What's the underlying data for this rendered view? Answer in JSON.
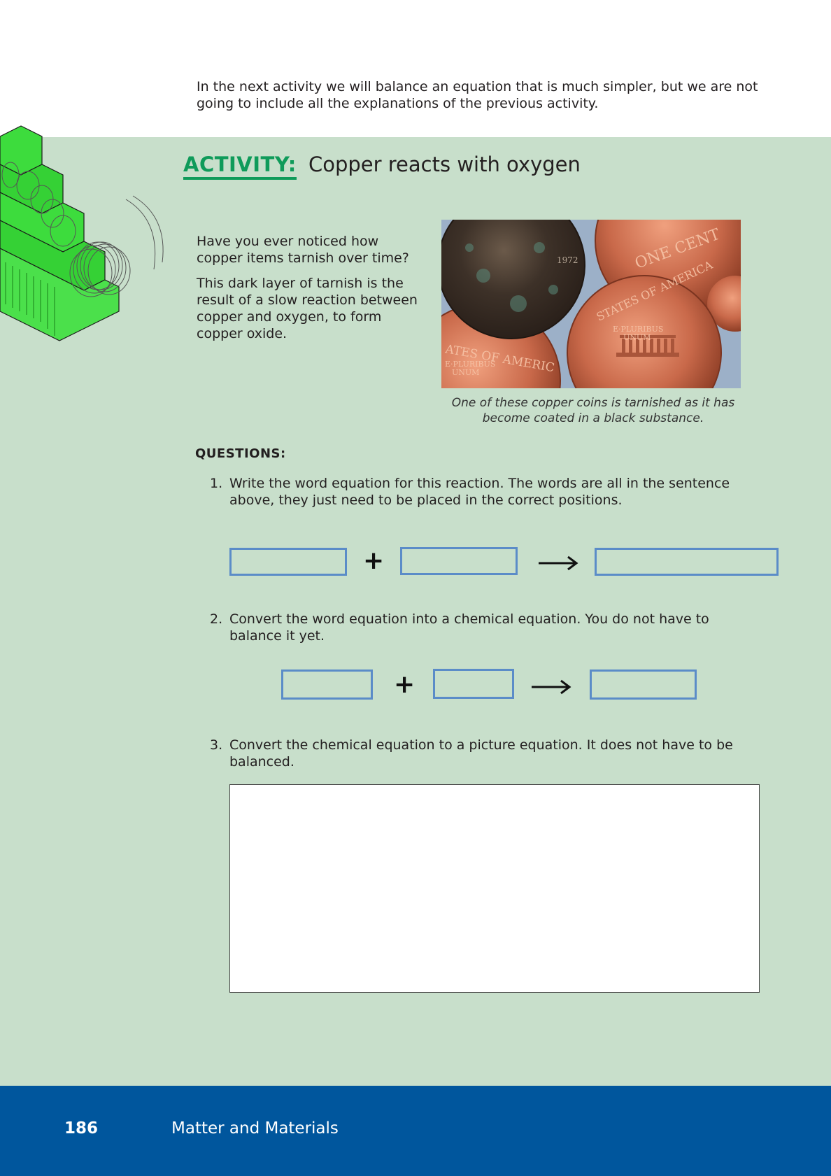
{
  "intro": "In the next activity we will balance an equation that is much simpler, but we are not going to include all the explanations of the previous activity.",
  "activity": {
    "label": "ACTIVITY:",
    "title": "Copper reacts with oxygen"
  },
  "body": {
    "p1": "Have you ever noticed how copper items tarnish over time?",
    "p2": "This dark layer of tarnish is the result of a slow reaction between copper and oxygen, to form copper oxide."
  },
  "photo": {
    "caption": "One of these copper coins is tarnished as it has become coated in a black substance.",
    "coin_texts": [
      "ONE CENT",
      "STATES OF AMERICA",
      "E·PLURIBUS",
      "UNUM",
      "ATES OF AMERIC",
      "1972"
    ]
  },
  "questions_heading": "QUESTIONS:",
  "questions": [
    {
      "num": "1.",
      "text": "Write the word equation for this reaction. The words are all in the sentence above, they just need to be placed in the correct positions."
    },
    {
      "num": "2.",
      "text": "Convert the word equation into a chemical equation. You do not have to balance it yet."
    },
    {
      "num": "3.",
      "text": "Convert the chemical equation to a picture equation. It does not have to be balanced."
    }
  ],
  "equation_symbols": {
    "plus": "+"
  },
  "colors": {
    "activity_green": "#0f9b5a",
    "panel_bg": "#c8dfcb",
    "answer_box_border": "#5b8cc8",
    "footer_bg": "#00569d"
  },
  "footer": {
    "page_number": "186",
    "book_title": "Matter and Materials"
  }
}
